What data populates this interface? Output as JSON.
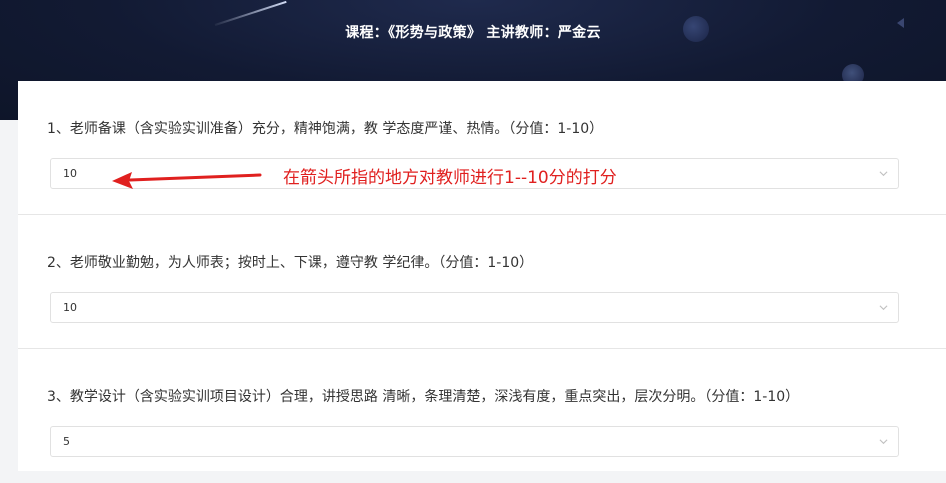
{
  "header": {
    "title": "课程：《形势与政策》 主讲教师：严金云"
  },
  "questions": [
    {
      "text": "1、老师备课（含实验实训准备）充分，精神饱满，教 学态度严谨、热情。（分值：1-10）",
      "selected": "10"
    },
    {
      "text": "2、老师敬业勤勉，为人师表；按时上、下课，遵守教 学纪律。（分值：1-10）",
      "selected": "10"
    },
    {
      "text": "3、教学设计（含实验实训项目设计）合理，讲授思路 清晰，条理清楚，深浅有度，重点突出，层次分明。（分值：1-10）",
      "selected": "5"
    }
  ],
  "annotation": {
    "text": "在箭头所指的地方对教师进行1--10分的打分",
    "color": "#e0201f"
  },
  "icons": {
    "select_arrow": "chevron-down-icon",
    "annotation_arrow": "red-arrow-icon"
  }
}
